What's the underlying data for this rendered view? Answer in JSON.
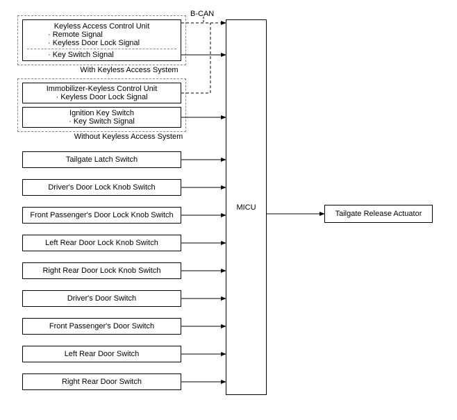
{
  "labels": {
    "bcan": "B-CAN",
    "with_keyless": "With Keyless Access System",
    "without_keyless": "Without Keyless Access System"
  },
  "keyless_unit": {
    "title": "Keyless Access Control Unit",
    "item1": "· Remote Signal",
    "item2": "· Keyless Door Lock Signal",
    "item3": "· Key Switch Signal"
  },
  "immobilizer": {
    "title": "Immobilizer-Keyless Control Unit",
    "item1": "· Keyless Door Lock Signal"
  },
  "ignition": {
    "title": "Ignition Key Switch",
    "item1": "· Key Switch Signal"
  },
  "switches": {
    "s1": "Tailgate Latch Switch",
    "s2": "Driver's Door Lock Knob Switch",
    "s3": "Front Passenger's Door Lock Knob Switch",
    "s4": "Left Rear Door Lock Knob Switch",
    "s5": "Right Rear Door Lock Knob Switch",
    "s6": "Driver's Door Switch",
    "s7": "Front Passenger's Door Switch",
    "s8": "Left Rear Door Switch",
    "s9": "Right Rear Door Switch"
  },
  "micu": "MICU",
  "output": "Tailgate Release Actuator"
}
